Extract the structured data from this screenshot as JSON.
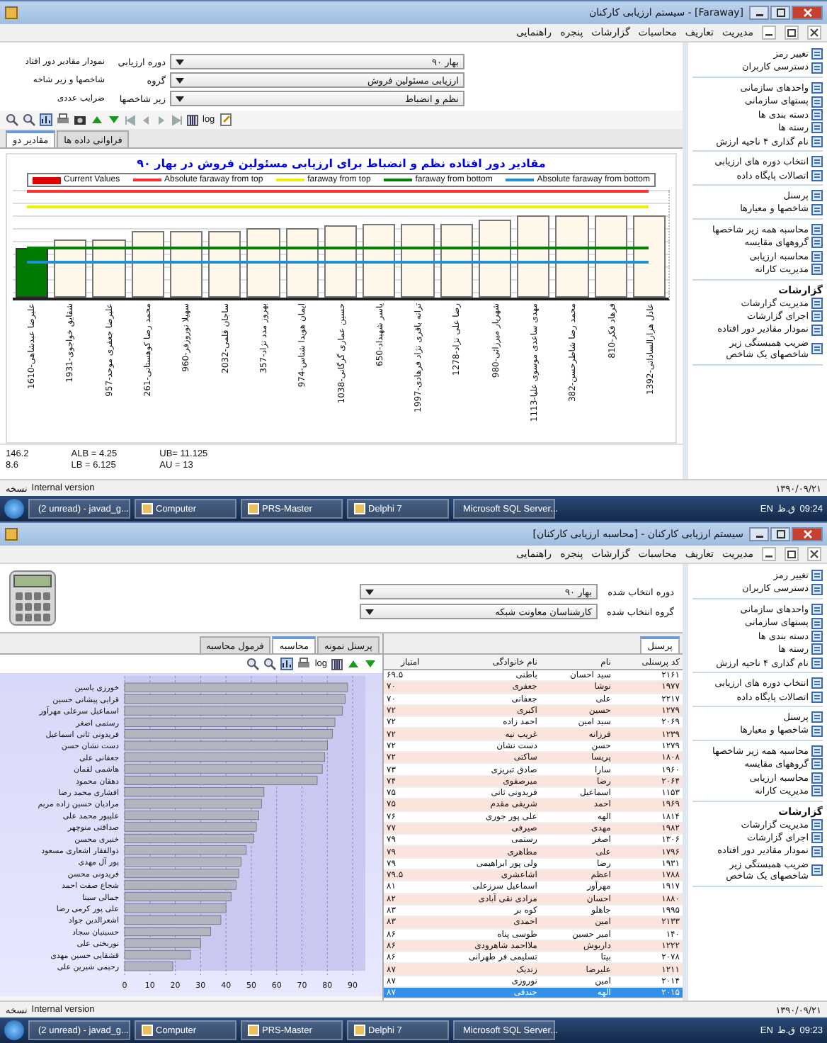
{
  "windows": [
    {
      "kind": "outliers",
      "title": "سیستم ارزیابی کارکنان - [Faraway]",
      "menu": [
        "مدیریت",
        "تعاریف",
        "محاسبات",
        "گزارشات",
        "پنجره",
        "راهنمایی"
      ],
      "form": {
        "side_labels": [
          "نمودار مقادیر دور افتاد",
          "شاخصها و زیر شاخه",
          "ضرایب عددی"
        ],
        "fields": [
          {
            "label": "دوره ارزیابی",
            "value": "بهار ۹۰"
          },
          {
            "label": "گروه",
            "value": "ارزیابی مسئولین فروش"
          },
          {
            "label": "زیر شاخصها",
            "value": "نظم و انضباط"
          }
        ]
      },
      "toolbar_label": "log",
      "tabs": [
        {
          "label": "فراوانی داده ها",
          "selected": false
        },
        {
          "label": "مقادیر دو",
          "selected": true
        }
      ],
      "chart_title": "مقادیر دور افتاده نظم و انضباط برای ارزیابی مسئولین فروش در بهار ۹۰",
      "legend": [
        {
          "label": "Absolute faraway from bottom",
          "color": "#1e90d8",
          "kind": "line"
        },
        {
          "label": "faraway from bottom",
          "color": "#008000",
          "kind": "line"
        },
        {
          "label": "faraway from top",
          "color": "#f0f000",
          "kind": "line"
        },
        {
          "label": "Absolute faraway from top",
          "color": "#ff3030",
          "kind": "line"
        },
        {
          "label": "Current Values",
          "color": "#e00000",
          "kind": "block"
        }
      ],
      "bar_labels": [
        "علیرضا عبدشاهی-1610",
        "شقایق خواجوی-1931",
        "علیرضا جعفری موحد-957",
        "محمد رضا کوهستانی-261",
        "سهیلا نوروزفر-960",
        "ساجان قلمی-2032",
        "بهروز مدد نژاد-357",
        "ایمان هویدا شناس-974",
        "حسین عماری گرگانی-1038",
        "یاسر شهبداد-650",
        "ترانه باقری نژاد فرهادی-1997",
        "رضا علی نژاد-1278",
        "شهریار میرزائی-980",
        "مهدی ساعدی موسوی علیا-1113",
        "محمد رضا شاطرحسن-382",
        "فرهاد فکر-810",
        "عادل هزارالساداتی-1392"
      ],
      "stats": [
        [
          "UB= 11.125",
          "AU = 13"
        ],
        [
          "ALB = 4.25",
          "LB = 6.125"
        ],
        [
          "146.2",
          "8.6"
        ]
      ],
      "sidebar": {
        "groups": [
          {
            "items": [
              "تغییر رمز",
              "دسترسی کاربران"
            ]
          },
          {
            "items": [
              "واحدهای سازمانی",
              "پستهای سازمانی",
              "دسته بندی ها",
              "رسته ها",
              "نام گذاری ۴ ناحیه ارزش"
            ]
          },
          {
            "items": [
              "انتخاب دوره های ارزیابی",
              "اتصالات پایگاه داده"
            ]
          },
          {
            "items": [
              "پرسنل",
              "شاخصها و معیارها"
            ]
          },
          {
            "items": [
              "محاسبه همه زیر شاخصها",
              "گروههای مقایسه",
              "محاسبه ارزیابی",
              "مدیریت کارانه"
            ]
          },
          {
            "title": "گزارشات",
            "items": [
              "مدیریت گزارشات",
              "اجرای گزارشات",
              "نمودار مقادیر دور افتاده",
              "ضریب همبستگی زیر شاخصهای یک شاخص"
            ]
          }
        ]
      },
      "status": {
        "version_label": "نسخه",
        "version": "Internal version",
        "date": "۱۳۹۰/۰۹/۲۱"
      },
      "taskbar": {
        "items": [
          "Microsoft SQL Server...",
          "Delphi 7",
          "PRS-Master",
          "Computer",
          "(2 unread) - javad_g..."
        ],
        "language": "EN",
        "time": "09:24",
        "period": "ق.ظ"
      }
    },
    {
      "kind": "evaluation",
      "title": "سیستم ارزیابی کارکنان - [محاسبه ارزیابی کارکنان]",
      "menu": [
        "مدیریت",
        "تعاریف",
        "محاسبات",
        "گزارشات",
        "پنجره",
        "راهنمایی"
      ],
      "form": {
        "fields": [
          {
            "label": "دوره انتخاب شده",
            "value": "بهار ۹۰"
          },
          {
            "label": "گروه انتخاب شده",
            "value": "کارشناسان معاونت شبکه"
          }
        ]
      },
      "tabs": [
        {
          "label": "پرسنل نمونه",
          "selected": false
        },
        {
          "label": "محاسبه",
          "selected": true
        },
        {
          "label": "فرمول محاسبه",
          "selected": false
        }
      ],
      "toolbar_label": "log",
      "chart_data": {
        "type": "bar",
        "orientation": "horizontal",
        "categories": [
          "خورزی یاسین",
          "قرایی پیشانی حسین",
          "اسماعیل سرعلی مهرآور",
          "رستمی اصغر",
          "فریدونی ثانی اسماعیل",
          "دست نشان حسن",
          "جعفانی علی",
          "هاشمی لقمان",
          "دهقان محمود",
          "افشاری محمد رضا",
          "مرادیان حسین زاده مریم",
          "علیپور محمد علی",
          "صداقتی منوچهر",
          "خنیری محسن",
          "ذوالفقار اشعاری مسعود",
          "پور آل مهدی",
          "فریدونی محسن",
          "شجاع صفت احمد",
          "جمالی سینا",
          "علی پور کرمی رضا",
          "اشعرالدین جواد",
          "حسینیان سجاد",
          "نوربختی علی",
          "قشقایی حسین مهدی",
          "رحیمی شیرین علی"
        ],
        "series": [
          {
            "color": "#b4b4c0",
            "values": [
              88,
              87,
              86,
              83,
              82,
              80,
              79,
              78,
              76,
              55,
              54,
              53,
              52,
              51,
              48,
              46,
              45,
              44,
              42,
              40,
              38,
              34,
              30,
              26,
              19
            ]
          }
        ],
        "xlim": [
          0,
          95
        ],
        "xticks": [
          0,
          10,
          20,
          30,
          40,
          50,
          60,
          70,
          80,
          90
        ],
        "grid": true
      },
      "table_tab": "پرسنل",
      "columns": [
        "کد پرسنلی",
        "نام",
        "نام خانوادگی",
        "امتیاز"
      ],
      "rows": [
        {
          "code": "۲۱۶۱",
          "first_name": "سید احسان",
          "last_name": "باطنی",
          "score": "۶۹.۵",
          "selected": false
        },
        {
          "code": "۱۹۷۷",
          "first_name": "نوشا",
          "last_name": "جعفری",
          "score": "۷۰",
          "selected": false
        },
        {
          "code": "۲۲۱۷",
          "first_name": "علی",
          "last_name": "جعفانی",
          "score": "۷۰",
          "selected": false
        },
        {
          "code": "۱۲۷۹",
          "first_name": "حسین",
          "last_name": "اکبری",
          "score": "۷۲",
          "selected": false
        },
        {
          "code": "۲۰۶۹",
          "first_name": "سید امین",
          "last_name": "احمد زاده",
          "score": "۷۲",
          "selected": false
        },
        {
          "code": "۱۲۳۹",
          "first_name": "فرزانه",
          "last_name": "غریب نیه",
          "score": "۷۲",
          "selected": false
        },
        {
          "code": "۱۲۷۹",
          "first_name": "حسن",
          "last_name": "دست نشان",
          "score": "۷۲",
          "selected": false
        },
        {
          "code": "۱۸۰۸",
          "first_name": "پریسا",
          "last_name": "ساکتی",
          "score": "۷۲",
          "selected": false
        },
        {
          "code": "۱۹۶۰",
          "first_name": "سارا",
          "last_name": "صادق تبریزی",
          "score": "۷۳",
          "selected": false
        },
        {
          "code": "۲۰۶۴",
          "first_name": "رضا",
          "last_name": "میرصفوی",
          "score": "۷۴",
          "selected": false
        },
        {
          "code": "۱۱۵۳",
          "first_name": "اسماعیل",
          "last_name": "فریدونی ثانی",
          "score": "۷۵",
          "selected": false
        },
        {
          "code": "۱۹۶۹",
          "first_name": "احمد",
          "last_name": "شریفی مقدم",
          "score": "۷۵",
          "selected": false
        },
        {
          "code": "۱۸۱۴",
          "first_name": "الهه",
          "last_name": "علی پور جوری",
          "score": "۷۶",
          "selected": false
        },
        {
          "code": "۱۹۸۲",
          "first_name": "مهدی",
          "last_name": "صیرفی",
          "score": "۷۷",
          "selected": false
        },
        {
          "code": "۱۳۰۶",
          "first_name": "اصغر",
          "last_name": "رستمی",
          "score": "۷۹",
          "selected": false
        },
        {
          "code": "۱۷۹۶",
          "first_name": "علی",
          "last_name": "مطاهری",
          "score": "۷۹",
          "selected": false
        },
        {
          "code": "۱۹۳۱",
          "first_name": "رضا",
          "last_name": "ولی پور ابراهیمی",
          "score": "۷۹",
          "selected": false
        },
        {
          "code": "۱۷۸۸",
          "first_name": "اعظم",
          "last_name": "اشاعشری",
          "score": "۷۹.۵",
          "selected": false
        },
        {
          "code": "۱۹۱۷",
          "first_name": "مهرآور",
          "last_name": "اسماعیل سرزعلی",
          "score": "۸۱",
          "selected": false
        },
        {
          "code": "۱۸۸۰",
          "first_name": "احسان",
          "last_name": "مرادی نقی آبادی",
          "score": "۸۲",
          "selected": false
        },
        {
          "code": "۱۹۹۵",
          "first_name": "جاهلو",
          "last_name": "کوه بر",
          "score": "۸۳",
          "selected": false
        },
        {
          "code": "۲۱۳۳",
          "first_name": "امین",
          "last_name": "احمدی",
          "score": "۸۳",
          "selected": false
        },
        {
          "code": "۱۴۰",
          "first_name": "امیر حسین",
          "last_name": "طوسی پناه",
          "score": "۸۶",
          "selected": false
        },
        {
          "code": "۱۲۲۲",
          "first_name": "داریوش",
          "last_name": "ملااحمد شاهرودی",
          "score": "۸۶",
          "selected": false
        },
        {
          "code": "۲۰۷۸",
          "first_name": "بیتا",
          "last_name": "تسلیمی فر طهرانی",
          "score": "۸۶",
          "selected": false
        },
        {
          "code": "۱۲۱۱",
          "first_name": "علیرضا",
          "last_name": "زندیک",
          "score": "۸۷",
          "selected": false
        },
        {
          "code": "۲۰۱۴",
          "first_name": "امین",
          "last_name": "نوروزی",
          "score": "۸۷",
          "selected": false
        },
        {
          "code": "۲۰۱۵",
          "first_name": "الهه",
          "last_name": "جندقی",
          "score": "۸۷",
          "selected": true
        }
      ],
      "sidebar": {
        "groups": [
          {
            "items": [
              "تغییر رمز",
              "دسترسی کاربران"
            ]
          },
          {
            "items": [
              "واحدهای سازمانی",
              "پستهای سازمانی",
              "دسته بندی ها",
              "رسته ها",
              "نام گذاری ۴ ناحیه ارزش"
            ]
          },
          {
            "items": [
              "انتخاب دوره های ارزیابی",
              "اتصالات پایگاه داده"
            ]
          },
          {
            "items": [
              "پرسنل",
              "شاخصها و معیارها"
            ]
          },
          {
            "items": [
              "محاسبه همه زیر شاخصها",
              "گروههای مقایسه",
              "محاسبه ارزیابی",
              "مدیریت کارانه"
            ]
          },
          {
            "title": "گزارشات",
            "items": [
              "مدیریت گزارشات",
              "اجرای گزارشات",
              "نمودار مقادیر دور افتاده",
              "ضریب همبستگی زیر شاخصهای یک شاخص"
            ]
          }
        ]
      },
      "status": {
        "version_label": "نسخه",
        "version": "Internal version",
        "date": "۱۳۹۰/۰۹/۲۱"
      },
      "taskbar": {
        "items": [
          "Microsoft SQL Server...",
          "Delphi 7",
          "PRS-Master",
          "Computer",
          "(2 unread) - javad_g..."
        ],
        "language": "EN",
        "time": "09:23",
        "period": "ق.ظ"
      }
    }
  ]
}
